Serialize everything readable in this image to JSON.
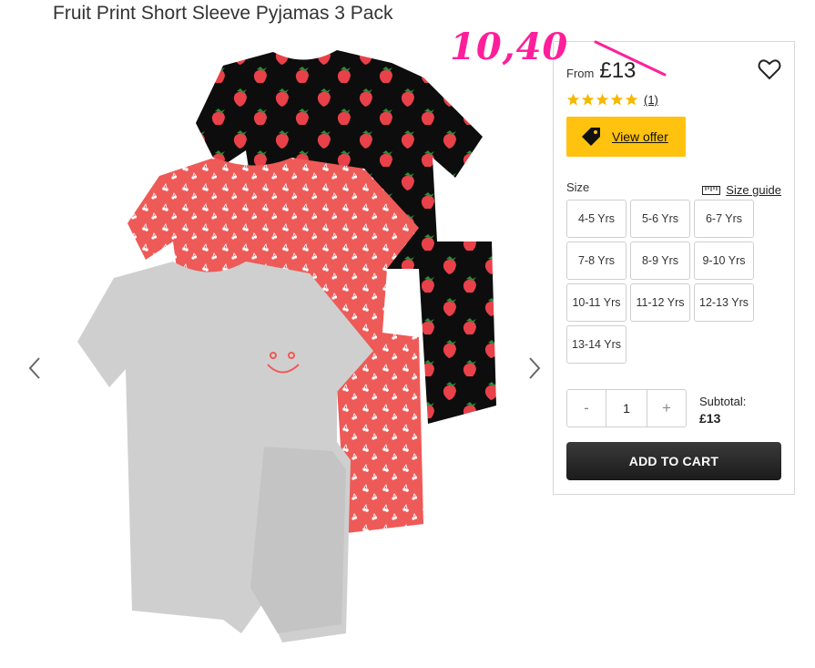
{
  "product": {
    "title": "Fruit Print Short Sleeve Pyjamas 3 Pack"
  },
  "annotation": {
    "handwritten_price": "10,40",
    "color": "#ff1f9a"
  },
  "panel": {
    "from_label": "From",
    "price": "£13",
    "rating_stars": 5,
    "rating_count": "(1)",
    "offer_label": "View offer",
    "size_label": "Size",
    "size_guide_label": "Size guide",
    "sizes": [
      "4-5 Yrs",
      "5-6 Yrs",
      "6-7 Yrs",
      "7-8 Yrs",
      "8-9 Yrs",
      "9-10 Yrs",
      "10-11 Yrs",
      "11-12 Yrs",
      "12-13 Yrs",
      "13-14 Yrs"
    ],
    "quantity": "1",
    "minus_label": "-",
    "plus_label": "+",
    "subtotal_label": "Subtotal:",
    "subtotal_value": "£13",
    "add_to_cart_label": "ADD TO CART"
  },
  "colors": {
    "offer": "#ffc20e",
    "star": "#f6b800",
    "cart_button": "#222222"
  },
  "icons": [
    "chevron-left-icon",
    "chevron-right-icon",
    "heart-icon",
    "star-icon",
    "price-tag-icon",
    "ruler-icon"
  ]
}
